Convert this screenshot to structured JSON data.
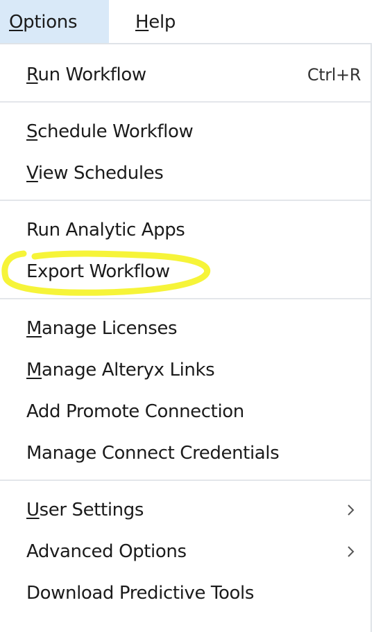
{
  "menubar": {
    "options": {
      "mnemonic": "O",
      "rest": "ptions"
    },
    "help": {
      "mnemonic": "H",
      "rest": "elp"
    },
    "language_icon": "globe-icon"
  },
  "menu": {
    "run_workflow": {
      "mnemonic": "R",
      "rest": "un Workflow",
      "shortcut": "Ctrl+R"
    },
    "schedule_workflow": {
      "mnemonic": "S",
      "rest": "chedule Workflow"
    },
    "view_schedules": {
      "mnemonic": "V",
      "rest": "iew Schedules"
    },
    "run_analytic_apps": {
      "label": "Run Analytic Apps"
    },
    "export_workflow": {
      "label": "Export Workflow"
    },
    "manage_licenses": {
      "mnemonic": "M",
      "rest": "anage Licenses"
    },
    "manage_alteryx_links": {
      "mnemonic": "M",
      "rest": "anage Alteryx Links"
    },
    "add_promote_connection": {
      "label": "Add Promote Connection"
    },
    "manage_connect_credentials": {
      "label": "Manage Connect Credentials"
    },
    "user_settings": {
      "mnemonic": "U",
      "rest": "ser Settings",
      "submenu_icon": "chevron-right-icon"
    },
    "advanced_options": {
      "label": "Advanced Options",
      "submenu_icon": "chevron-right-icon"
    },
    "download_predictive_tools": {
      "label": "Download Predictive Tools"
    }
  },
  "colors": {
    "active_menubar_bg": "#d9e9f8",
    "highlight_marker": "#f5f216"
  }
}
